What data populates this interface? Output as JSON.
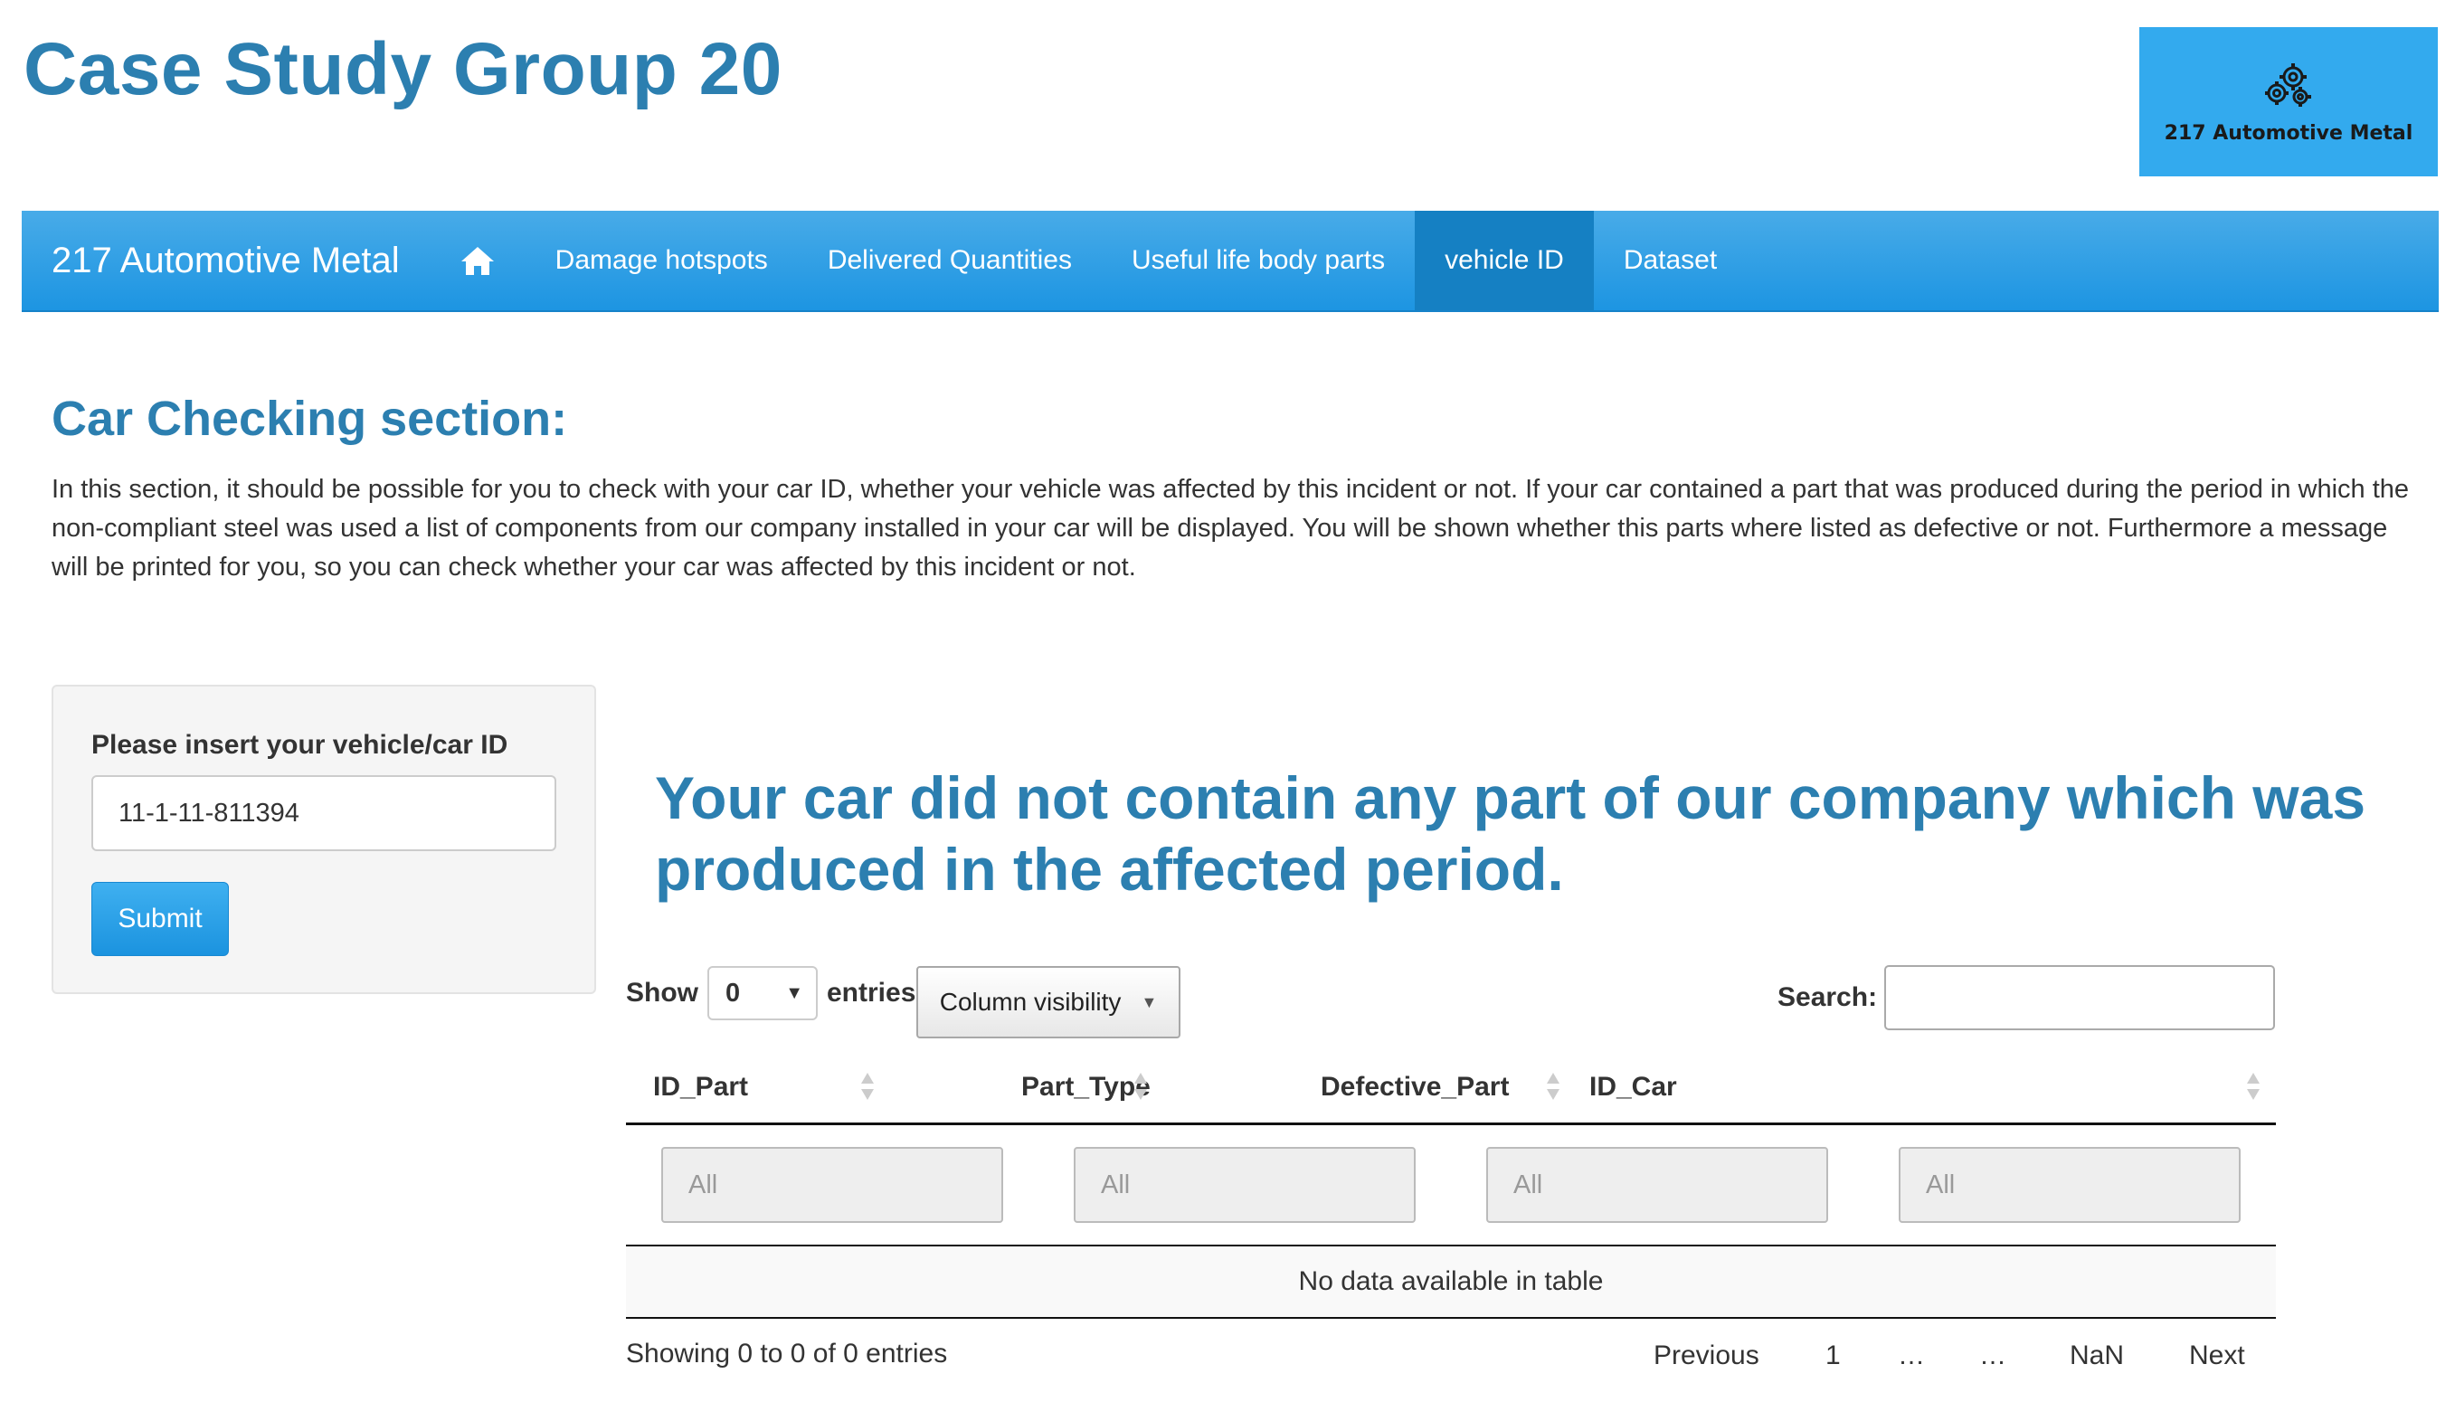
{
  "header": {
    "title": "Case Study Group 20",
    "logo_text": "217 Automotive Metal",
    "logo_bg": "#33aaee",
    "logo_icon": "gears-icon"
  },
  "navbar": {
    "brand": "217 Automotive Metal",
    "home_icon": "home-icon",
    "items": [
      {
        "label": "Damage hotspots",
        "active": false
      },
      {
        "label": "Delivered Quantities",
        "active": false
      },
      {
        "label": "Useful life body parts",
        "active": false
      },
      {
        "label": "vehicle ID",
        "active": true
      },
      {
        "label": "Dataset",
        "active": false
      }
    ],
    "bg": "#2a9fe6",
    "active_bg": "#1580c3"
  },
  "section": {
    "title": "Car Checking section:",
    "intro": "In this section, it should be possible for you to check with your car ID, whether your vehicle was affected by this incident or not. If your car contained a part that was produced during the period in which the non-compliant steel was used a list of components from our company installed in your car will be displayed. You will be shown whether this parts where listed as defective or not. Furthermore a message will be printed for you, so you can check whether your car was affected by this incident or not."
  },
  "form": {
    "label": "Please insert your vehicle/car ID",
    "value": "11-1-11-811394",
    "submit_label": "Submit"
  },
  "result": {
    "message": "Your car did not contain any part of our company which was produced in the affected period."
  },
  "table": {
    "show_label": "Show",
    "entries_label": "entries",
    "page_length": "0",
    "colvis_label": "Column visibility",
    "search_label": "Search:",
    "search_value": "",
    "columns": [
      "ID_Part",
      "Part_Type",
      "Defective_Part",
      "ID_Car"
    ],
    "filter_placeholder": "All",
    "empty_message": "No data available in table",
    "info": "Showing 0 to 0 of 0 entries",
    "pagination": {
      "previous": "Previous",
      "page1": "1",
      "ellipsis1": "…",
      "ellipsis2": "…",
      "last": "NaN",
      "next": "Next"
    }
  },
  "colors": {
    "heading": "#2c7fb0",
    "button": "#2aa0e8"
  }
}
